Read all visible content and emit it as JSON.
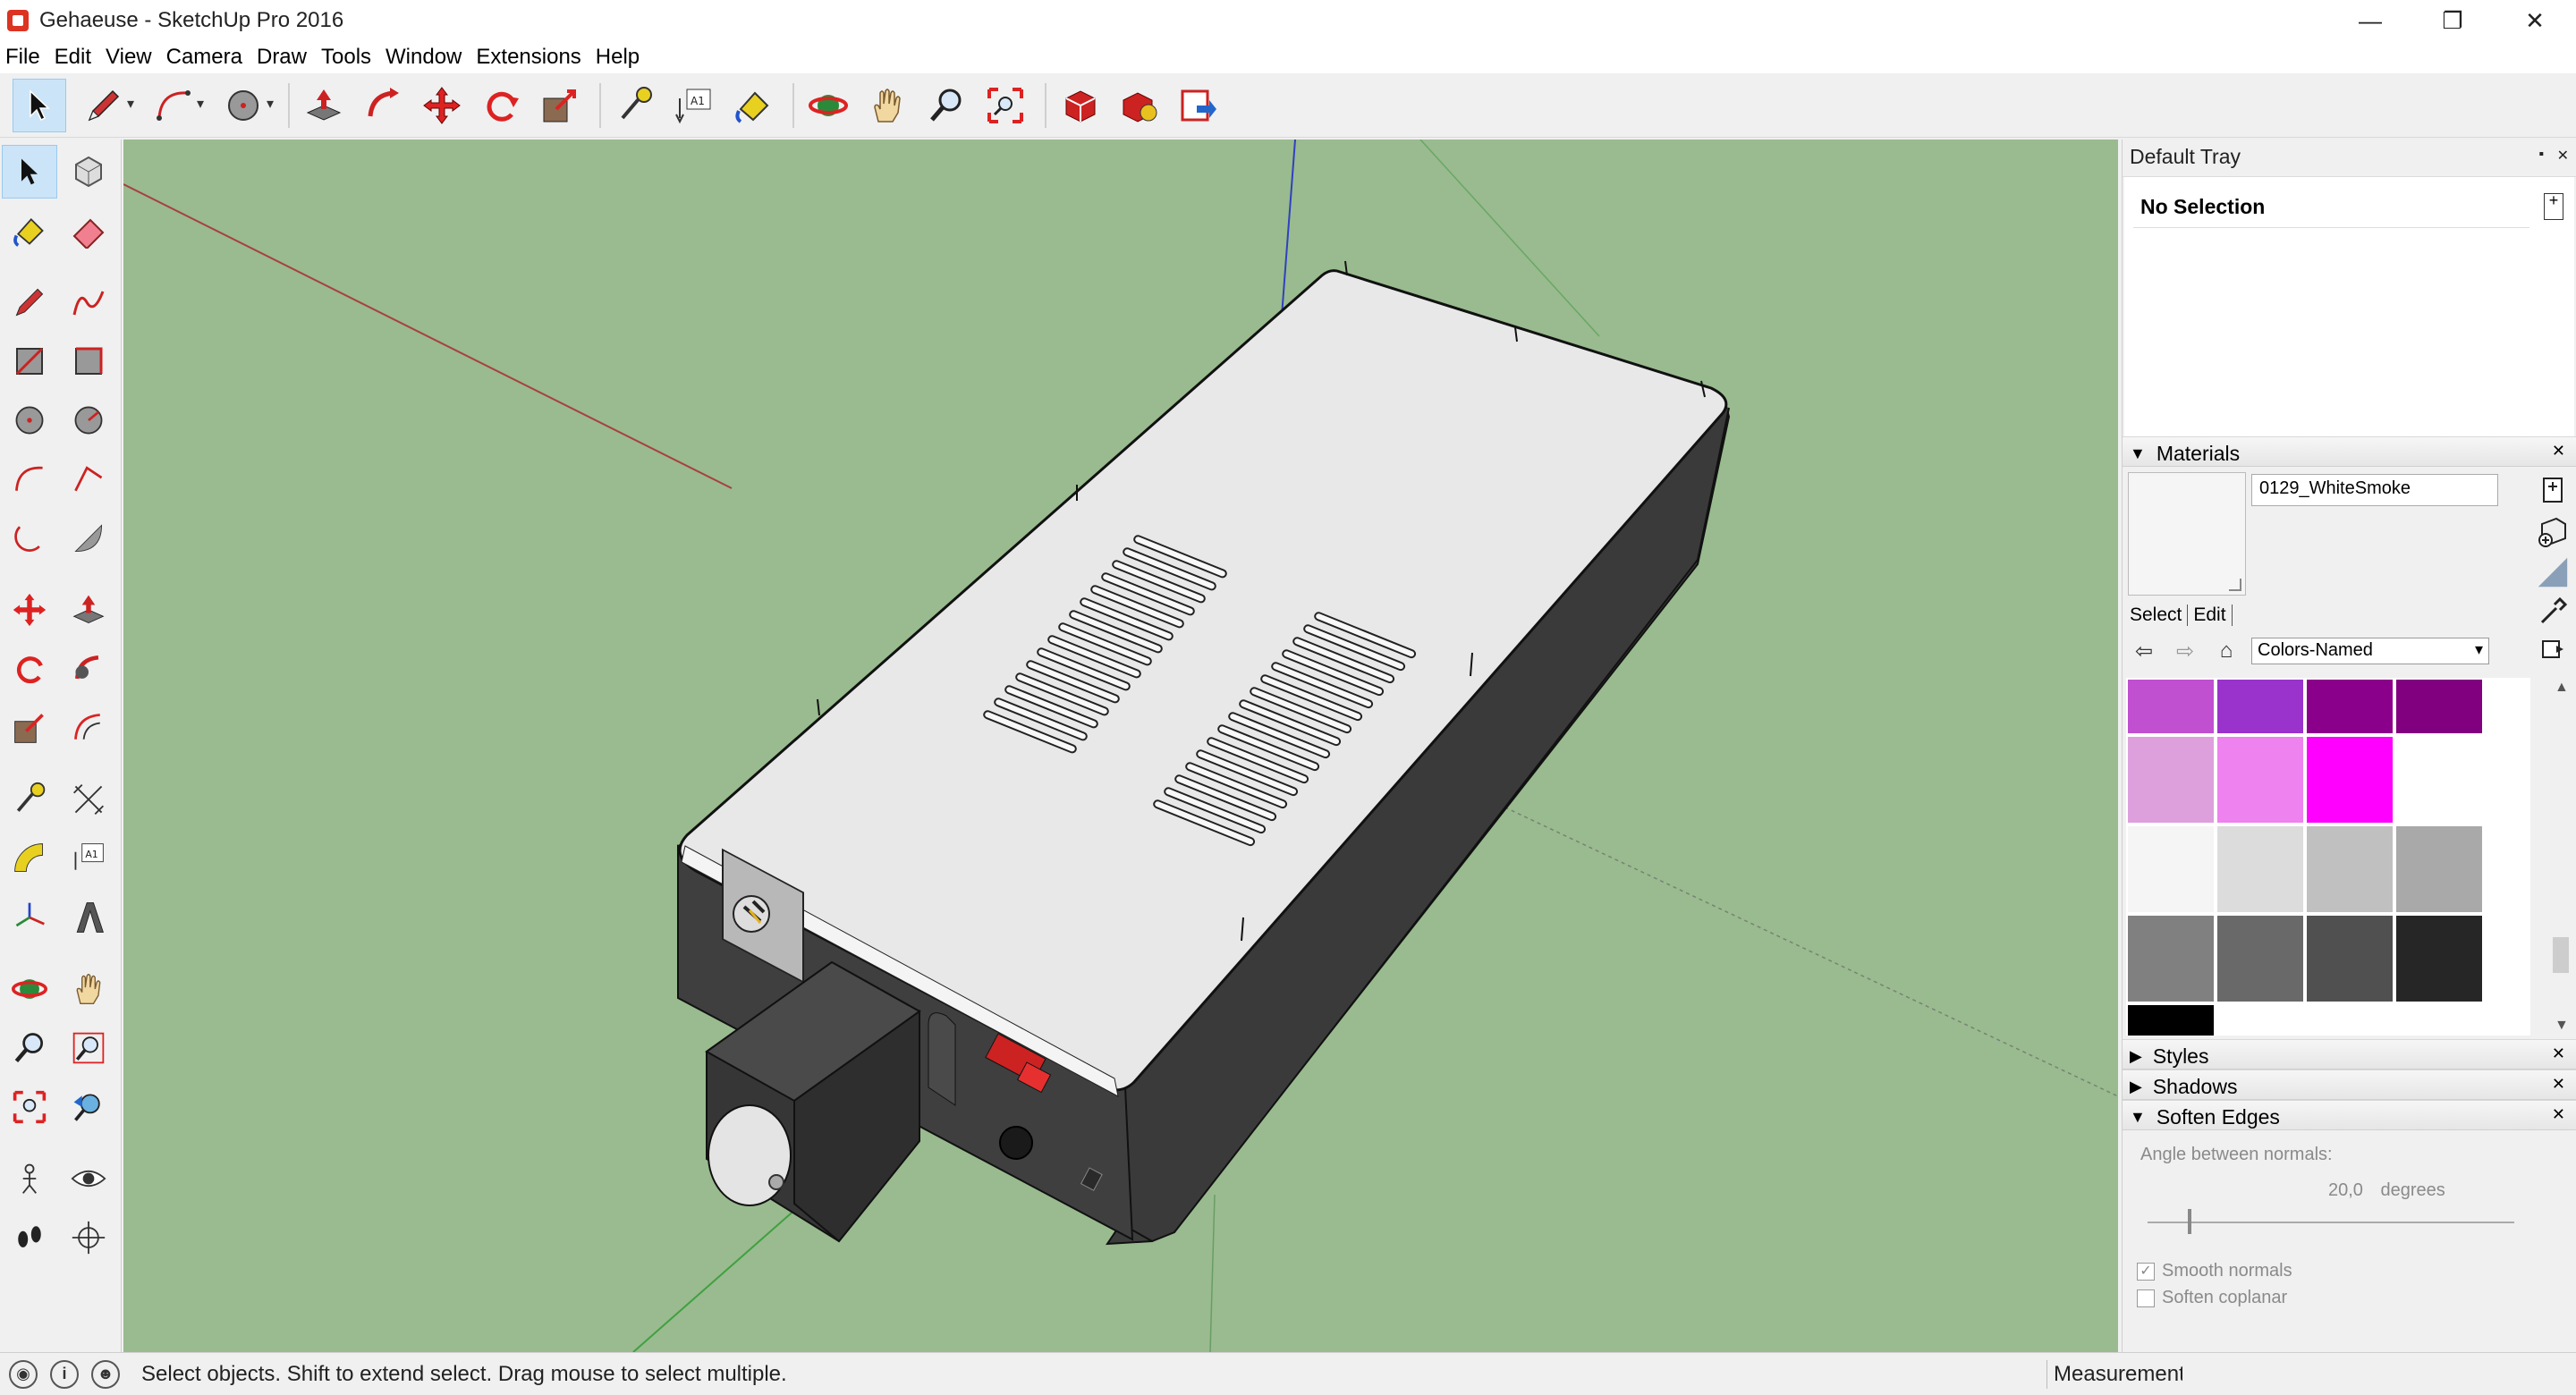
{
  "window": {
    "title": "Gehaeuse - SketchUp Pro 2016",
    "minimize": "—",
    "restore": "❐",
    "close": "✕"
  },
  "menu": [
    "File",
    "Edit",
    "View",
    "Camera",
    "Draw",
    "Tools",
    "Window",
    "Extensions",
    "Help"
  ],
  "toolbar_top": [
    {
      "name": "select-tool",
      "icon": "arrow-cursor-icon"
    },
    {
      "name": "pencil-tool",
      "icon": "pencil-icon"
    },
    {
      "name": "arc-tool",
      "icon": "arc-icon"
    },
    {
      "name": "circle-tool",
      "icon": "circle-icon"
    },
    {
      "name": "push-pull-tool",
      "icon": "push-pull-icon"
    },
    {
      "name": "follow-me-tool",
      "icon": "follow-me-icon"
    },
    {
      "name": "move-tool",
      "icon": "move-icon"
    },
    {
      "name": "rotate-tool",
      "icon": "rotate-icon"
    },
    {
      "name": "scale-tool",
      "icon": "scale-icon"
    },
    {
      "name": "tape-measure-tool",
      "icon": "tape-measure-icon"
    },
    {
      "name": "text-tool",
      "icon": "text-icon"
    },
    {
      "name": "paint-bucket-tool",
      "icon": "paint-bucket-icon"
    },
    {
      "name": "orbit-tool",
      "icon": "orbit-icon"
    },
    {
      "name": "pan-tool",
      "icon": "pan-hand-icon"
    },
    {
      "name": "zoom-tool",
      "icon": "zoom-icon"
    },
    {
      "name": "zoom-extents-tool",
      "icon": "zoom-extents-icon"
    },
    {
      "name": "warehouse-tool",
      "icon": "3d-warehouse-icon"
    },
    {
      "name": "extension-warehouse-tool",
      "icon": "extension-warehouse-icon"
    },
    {
      "name": "send-to-layout-tool",
      "icon": "send-to-layout-icon"
    }
  ],
  "tray": {
    "title": "Default Tray",
    "entity_info": {
      "title": "No Selection"
    },
    "materials": {
      "header": "Materials",
      "material_name": "0129_WhiteSmoke",
      "tab_select": "Select",
      "tab_edit": "Edit",
      "collection": "Colors-Named",
      "swatches": [
        "#c050d0",
        "#9a33cc",
        "#8b008b",
        "#800080",
        "#dda0dd",
        "#ee82ee",
        "#ff00ff",
        "#ffffff",
        "#f5f5f5",
        "#dcdcdc",
        "#c0c0c0",
        "#a9a9a9",
        "#808080",
        "#696969",
        "#505050",
        "#262626",
        "#000000"
      ]
    },
    "styles": {
      "header": "Styles"
    },
    "shadows": {
      "header": "Shadows"
    },
    "soften_edges": {
      "header": "Soften Edges",
      "angle_label": "Angle between normals:",
      "angle_value": "20,0",
      "angle_unit": "degrees",
      "smooth_normals": "Smooth normals",
      "soften_coplanar": "Soften coplanar",
      "angle_fraction": 0.11
    }
  },
  "status": {
    "message": "Select objects. Shift to extend select. Drag mouse to select multiple.",
    "measurements_label": "Measurements",
    "info_icon": "i"
  },
  "colors": {
    "ground": "#99bb8f",
    "box_top": "#e8e8e8",
    "box_side": "#3a3a3a",
    "axis_red": "#b04040",
    "axis_blue": "#3040c0",
    "axis_green": "#40a040"
  }
}
